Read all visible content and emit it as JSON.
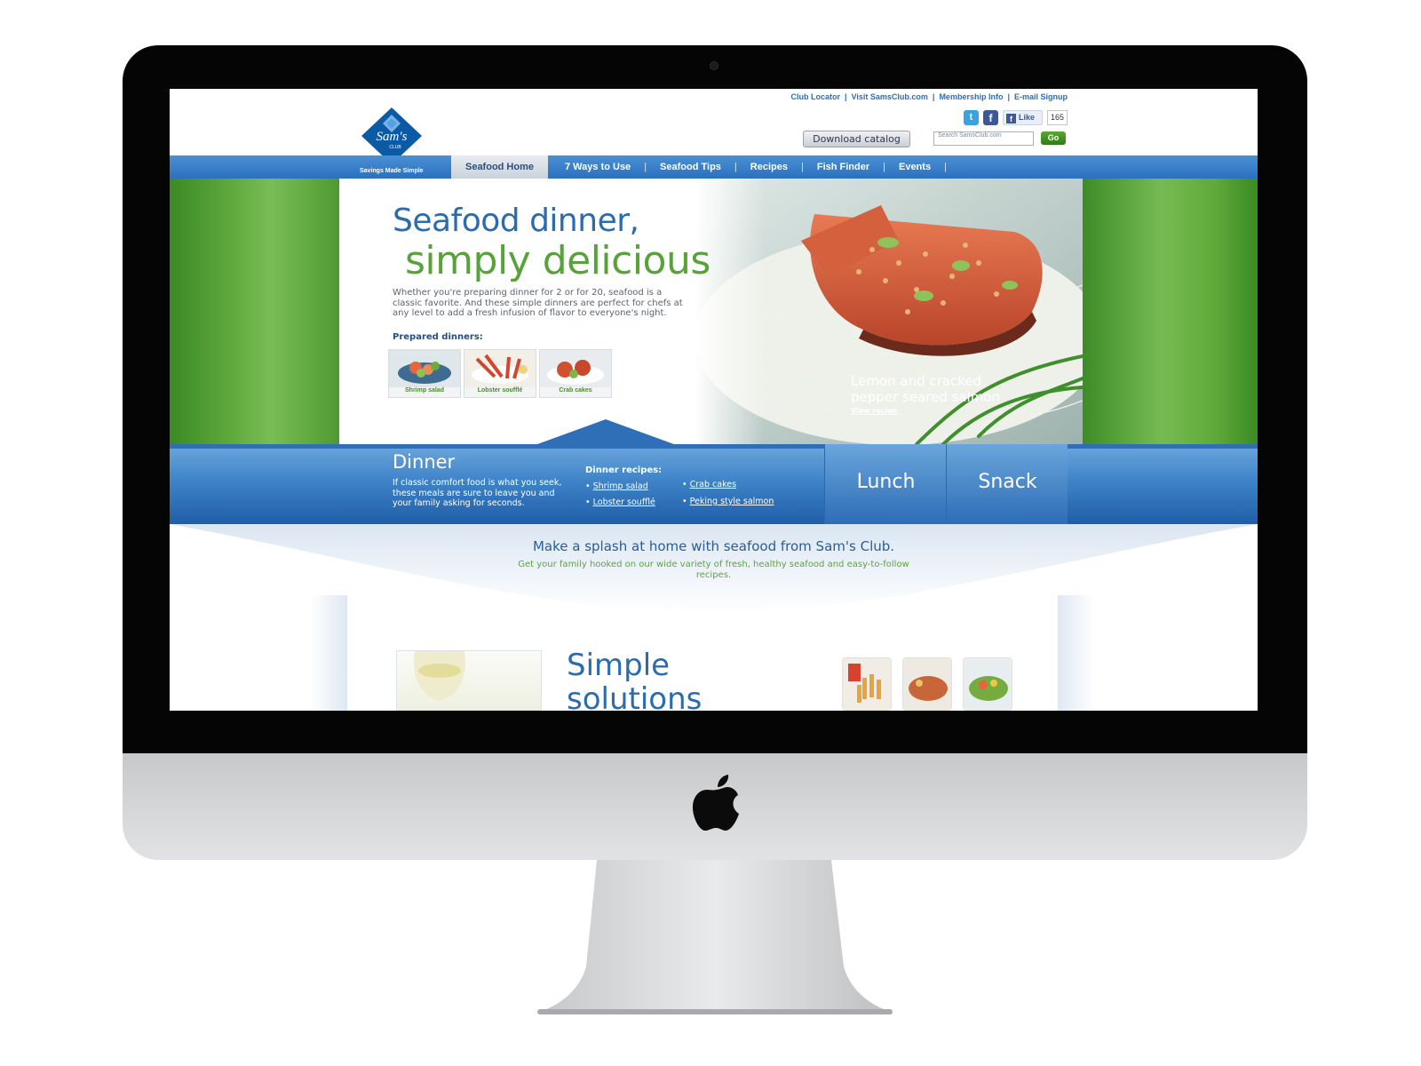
{
  "top_links": [
    "Club Locator",
    "Visit SamsClub.com",
    "Membership Info",
    "E-mail Signup"
  ],
  "logo": {
    "brand": "Sam's Club",
    "tagline": "Savings Made Simple"
  },
  "social": {
    "like_label": "Like",
    "like_count": "165"
  },
  "header": {
    "download_label": "Download catalog",
    "search_placeholder": "Search SamsClub.com",
    "go_label": "Go"
  },
  "nav": {
    "home": "Seafood Home",
    "items": [
      "7 Ways to Use",
      "Seafood Tips",
      "Recipes",
      "Fish Finder",
      "Events"
    ]
  },
  "hero": {
    "headline_line1": "Seafood dinner,",
    "headline_line2": "simply delicious",
    "intro": "Whether you're preparing dinner for 2 or for 20, seafood is a classic favorite. And these simple dinners are perfect for chefs at any level to add a fresh infusion of flavor to everyone's night.",
    "prepared_label": "Prepared dinners:",
    "thumbs": [
      "Shrimp salad",
      "Lobster soufflé",
      "Crab cakes"
    ],
    "photo_caption": "Lemon and cracked pepper seared salmon",
    "view_recipe": "View recipe"
  },
  "meal_band": {
    "dinner_title": "Dinner",
    "dinner_desc": "If classic comfort food is what you seek, these meals are sure to leave you and your family asking for seconds.",
    "recipes_label": "Dinner recipes:",
    "recipes": [
      "Shrimp salad",
      "Lobster soufflé",
      "Crab cakes",
      "Peking style salmon"
    ],
    "tabs": [
      "Lunch",
      "Snack"
    ]
  },
  "splash": {
    "title": "Make a splash at home with seafood from Sam's Club.",
    "subtitle": "Get your family hooked on our wide variety of fresh, healthy seafood and easy-to-follow recipes."
  },
  "lower": {
    "title_line1": "Simple",
    "title_line2": "solutions"
  },
  "colors": {
    "brand_blue": "#2a70bf",
    "brand_green": "#58a23a",
    "logo_blue": "#0b5aa5"
  }
}
